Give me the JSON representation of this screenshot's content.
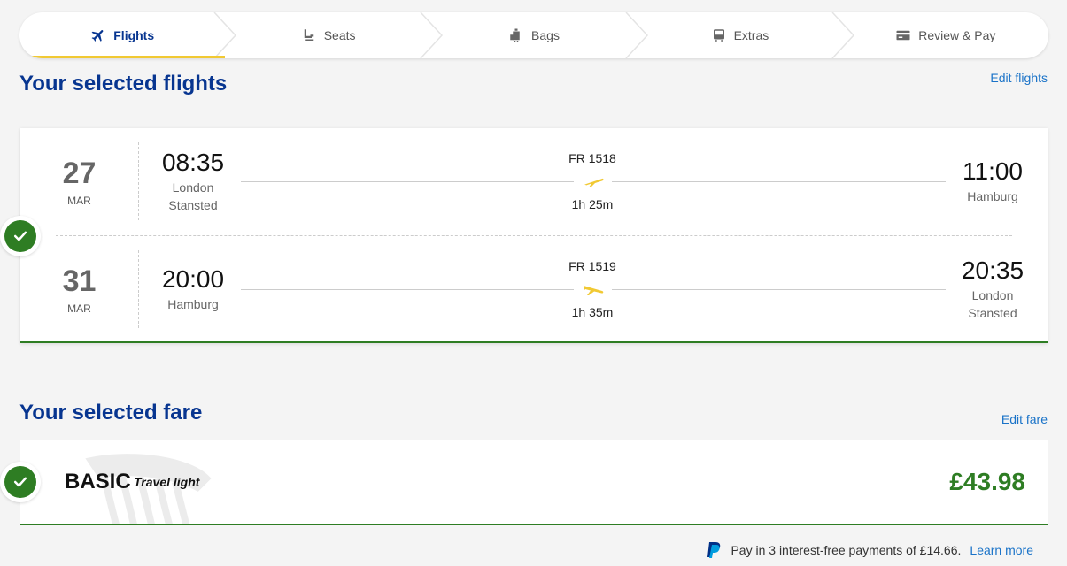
{
  "steps": [
    {
      "label": "Flights",
      "icon": "plane-icon",
      "active": true
    },
    {
      "label": "Seats",
      "icon": "seat-icon",
      "active": false
    },
    {
      "label": "Bags",
      "icon": "bag-icon",
      "active": false
    },
    {
      "label": "Extras",
      "icon": "bus-icon",
      "active": false
    },
    {
      "label": "Review & Pay",
      "icon": "card-icon",
      "active": false
    }
  ],
  "flights_section": {
    "title": "Your selected flights",
    "edit_label": "Edit flights"
  },
  "flights": [
    {
      "day": "27",
      "month": "MAR",
      "dep_time": "08:35",
      "dep_city_1": "London",
      "dep_city_2": "Stansted",
      "flight_no": "FR 1518",
      "duration": "1h 25m",
      "arr_time": "11:00",
      "arr_city_1": "Hamburg",
      "arr_city_2": ""
    },
    {
      "day": "31",
      "month": "MAR",
      "dep_time": "20:00",
      "dep_city_1": "Hamburg",
      "dep_city_2": "",
      "flight_no": "FR 1519",
      "duration": "1h 35m",
      "arr_time": "20:35",
      "arr_city_1": "London",
      "arr_city_2": "Stansted"
    }
  ],
  "fare_section": {
    "title": "Your selected fare",
    "edit_label": "Edit fare",
    "fare_name": "BASIC",
    "fare_tag": "Travel light",
    "price": "£43.98"
  },
  "paypal": {
    "text": "Pay in 3 interest-free payments of £14.66.",
    "link": "Learn more"
  },
  "colors": {
    "brand_blue": "#073590",
    "accent_yellow": "#f1c933",
    "success_green": "#2e7d23",
    "link_blue": "#1a73c8"
  }
}
